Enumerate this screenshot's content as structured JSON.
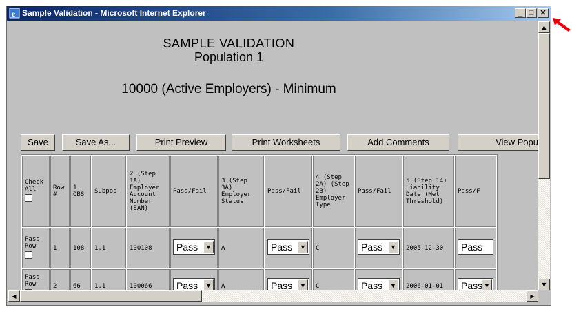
{
  "window": {
    "title": "Sample Validation - Microsoft Internet Explorer",
    "minimize_glyph": "_",
    "maximize_glyph": "□",
    "close_glyph": "✕"
  },
  "page": {
    "heading1": "SAMPLE VALIDATION",
    "heading2": "Population 1",
    "heading3": "10000 (Active Employers) - Minimum"
  },
  "toolbar": {
    "save": "Save",
    "save_as": "Save As...",
    "print_preview": "Print Preview",
    "print_worksheets": "Print Worksheets",
    "add_comments": "Add Comments",
    "view_population": "View Popu"
  },
  "table": {
    "headers": {
      "check_all": "Check All",
      "row": "Row #",
      "obs": "1 OBS",
      "subpop": "Subpop",
      "col2": "2 (Step 1A) Employer Account Number (EAN)",
      "pf1": "Pass/Fail",
      "col3": "3 (Step 3A) Employer Status",
      "pf2": "Pass/Fail",
      "col4": "4 (Step 2A) (Step 2B) Employer Type",
      "pf3": "Pass/Fail",
      "col5": "5 (Step 14) Liability Date (Met Threshold)",
      "pf4": "Pass/F"
    },
    "rows": [
      {
        "pass_row": "Pass Row",
        "row": "1",
        "obs": "108",
        "subpop": "1.1",
        "ean": "100108",
        "pf1": "Pass",
        "status": "A",
        "pf2": "Pass",
        "type": "C",
        "pf3": "Pass",
        "date": "2005-12-30",
        "pf4": "Pass"
      },
      {
        "pass_row": "Pass Row",
        "row": "2",
        "obs": "66",
        "subpop": "1.1",
        "ean": "100066",
        "pf1": "Pass",
        "status": "A",
        "pf2": "Pass",
        "type": "C",
        "pf3": "Pass",
        "date": "2006-01-01",
        "pf4": "Pass"
      }
    ]
  },
  "colors": {
    "titlebar": "#0a246a",
    "pointer": "#e8000b"
  }
}
